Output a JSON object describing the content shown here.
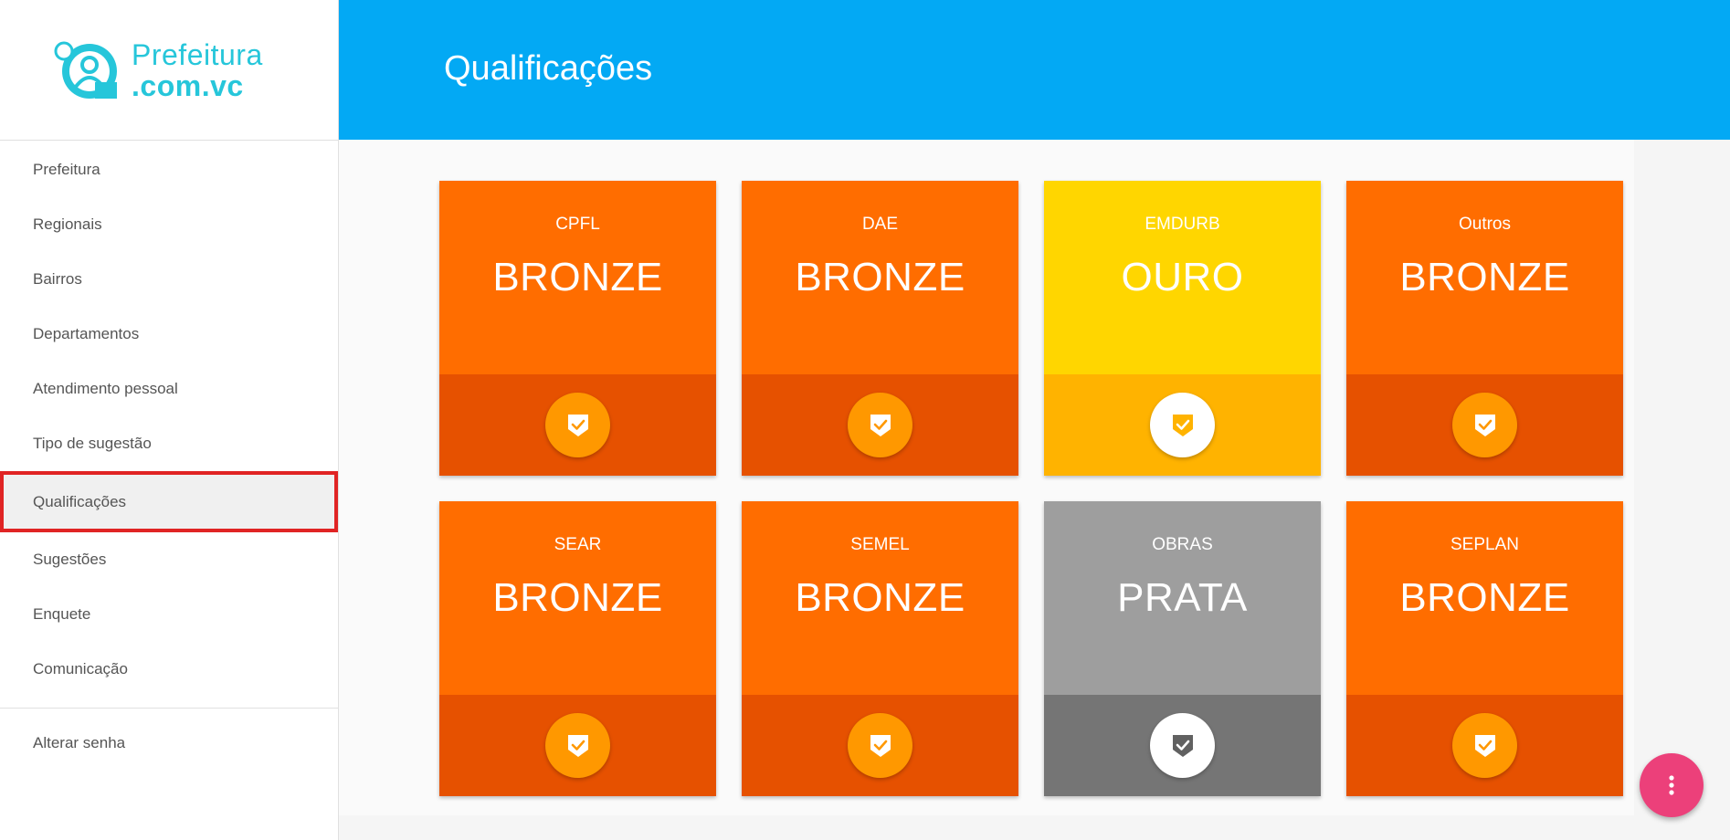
{
  "app": {
    "logo_line1": "Prefeitura",
    "logo_line2": ".com.vc",
    "brand_color": "#26c6da"
  },
  "header": {
    "title": "Qualificações",
    "color": "#03a9f4"
  },
  "sidebar": {
    "items": [
      {
        "label": "Prefeitura"
      },
      {
        "label": "Regionais"
      },
      {
        "label": "Bairros"
      },
      {
        "label": "Departamentos"
      },
      {
        "label": "Atendimento pessoal"
      },
      {
        "label": "Tipo de sugestão"
      },
      {
        "label": "Qualificações",
        "active": true
      },
      {
        "label": "Sugestões"
      },
      {
        "label": "Enquete"
      },
      {
        "label": "Comunicação"
      }
    ],
    "account_items": [
      {
        "label": "Alterar senha"
      }
    ]
  },
  "cards": [
    {
      "name": "CPFL",
      "level": "BRONZE",
      "tier": "bronze",
      "icon": "shield-check-icon"
    },
    {
      "name": "DAE",
      "level": "BRONZE",
      "tier": "bronze",
      "icon": "shield-check-icon"
    },
    {
      "name": "EMDURB",
      "level": "OURO",
      "tier": "gold",
      "icon": "shield-check-icon"
    },
    {
      "name": "Outros",
      "level": "BRONZE",
      "tier": "bronze",
      "icon": "shield-check-icon"
    },
    {
      "name": "SEAR",
      "level": "BRONZE",
      "tier": "bronze",
      "icon": "shield-check-icon"
    },
    {
      "name": "SEMEL",
      "level": "BRONZE",
      "tier": "bronze",
      "icon": "shield-check-icon"
    },
    {
      "name": "OBRAS",
      "level": "PRATA",
      "tier": "silver",
      "icon": "shield-check-icon"
    },
    {
      "name": "SEPLAN",
      "level": "BRONZE",
      "tier": "bronze",
      "icon": "shield-check-icon"
    }
  ],
  "tier_colors": {
    "bronze": {
      "top": "#ff6d00",
      "bottom": "#e65100",
      "badge": "#ff9800",
      "shield": "#ffffff",
      "check": "#ff9800"
    },
    "gold": {
      "top": "#ffd600",
      "bottom": "#ffb300",
      "badge": "#ffffff",
      "shield": "#ffb300",
      "check": "#ffffff"
    },
    "silver": {
      "top": "#9e9e9e",
      "bottom": "#757575",
      "badge": "#ffffff",
      "shield": "#616161",
      "check": "#ffffff"
    }
  },
  "fab": {
    "icon": "more-vert-icon",
    "color": "#ec407a"
  }
}
